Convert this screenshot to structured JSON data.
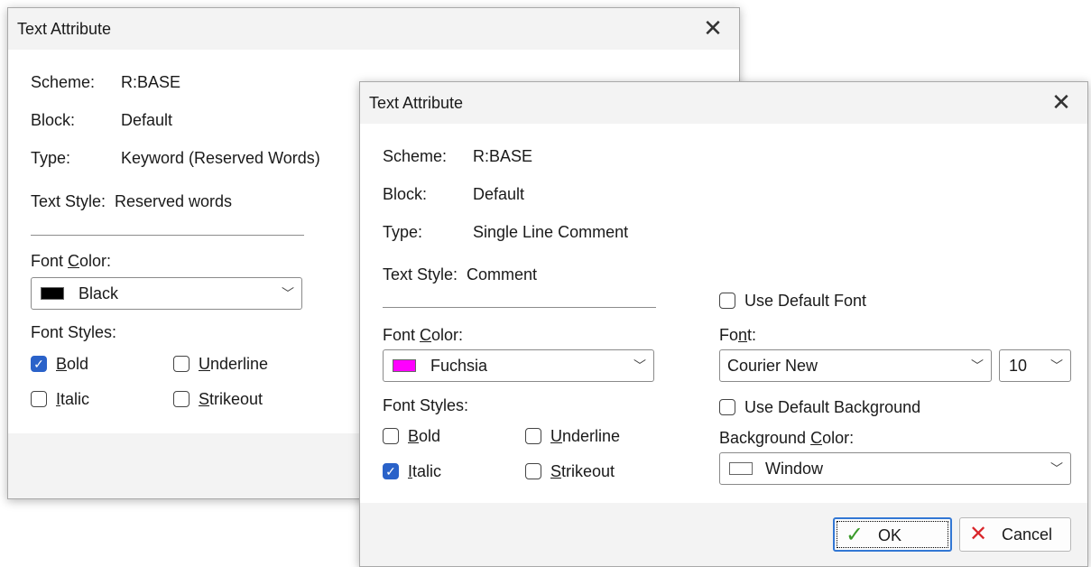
{
  "dialog_back": {
    "title": "Text Attribute",
    "scheme_label": "Scheme:",
    "scheme_value": "R:BASE",
    "block_label": "Block:",
    "block_value": "Default",
    "type_label": "Type:",
    "type_value": "Keyword (Reserved Words)",
    "text_style_label": "Text Style:",
    "text_style_value": "Reserved words",
    "font_color_label": "Font Color:",
    "font_color_value": "Black",
    "font_color_swatch": "#000000",
    "font_styles_label": "Font Styles:",
    "bold": {
      "label": "Bold",
      "checked": true
    },
    "underline": {
      "label": "Underline",
      "checked": false
    },
    "italic": {
      "label": "Italic",
      "checked": false
    },
    "strikeout": {
      "label": "Strikeout",
      "checked": false
    }
  },
  "dialog_front": {
    "title": "Text Attribute",
    "scheme_label": "Scheme:",
    "scheme_value": "R:BASE",
    "block_label": "Block:",
    "block_value": "Default",
    "type_label": "Type:",
    "type_value": "Single Line Comment",
    "text_style_label": "Text Style:",
    "text_style_value": "Comment",
    "font_color_label": "Font Color:",
    "font_color_value": "Fuchsia",
    "font_color_swatch": "#ff00ff",
    "font_styles_label": "Font Styles:",
    "bold": {
      "label": "Bold",
      "checked": false
    },
    "underline": {
      "label": "Underline",
      "checked": false
    },
    "italic": {
      "label": "Italic",
      "checked": true
    },
    "strikeout": {
      "label": "Strikeout",
      "checked": false
    },
    "use_default_font": {
      "label": "Use Default Font",
      "checked": false
    },
    "font_label": "Font:",
    "font_value": "Courier New",
    "font_size_value": "10",
    "use_default_background": {
      "label": "Use Default Background",
      "checked": false
    },
    "background_color_label": "Background Color:",
    "background_color_value": "Window",
    "background_swatch": "#ffffff",
    "ok_label": "OK",
    "cancel_label": "Cancel"
  },
  "colors": {
    "check_accent": "#2a62c9",
    "ok_icon": "#3a9a2a",
    "cancel_icon": "#d9262b"
  }
}
